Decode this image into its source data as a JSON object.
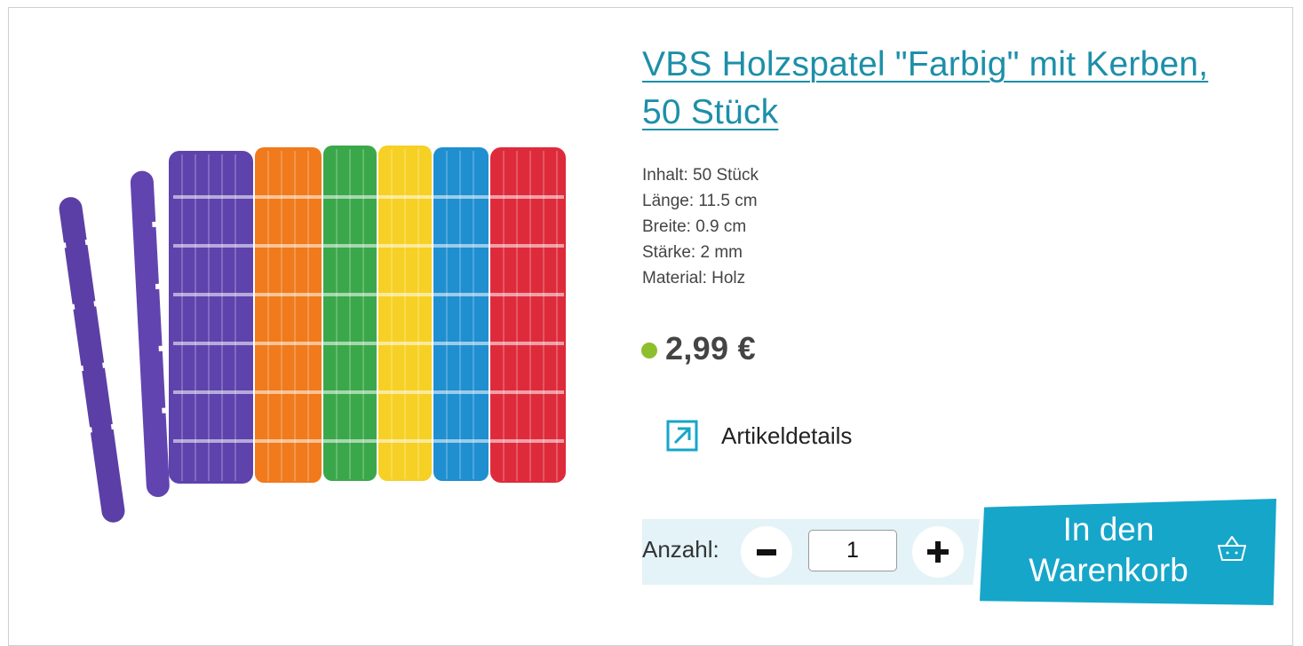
{
  "product": {
    "title": "VBS Holzspatel \"Farbig\" mit Kerben, 50 Stück",
    "image_alt": "Bunte Holzspatel mit Kerben",
    "specs": [
      "Inhalt: 50 Stück",
      "Länge: 11.5 cm",
      "Breite: 0.9 cm",
      "Stärke: 2 mm",
      "Material: Holz"
    ],
    "price": "2,99 €",
    "stock_color": "#8dbf2e",
    "details_label": "Artikeldetails",
    "details_icon": "external-arrow-icon"
  },
  "quantity": {
    "label": "Anzahl:",
    "value": "1",
    "minus_icon": "minus-icon",
    "plus_icon": "plus-icon"
  },
  "cart": {
    "line1": "In den",
    "line2": "Warenkorb",
    "icon": "basket-icon"
  },
  "colors": {
    "accent": "#16a6c9",
    "link": "#1d8fa8",
    "band": "#e3f3f8"
  }
}
